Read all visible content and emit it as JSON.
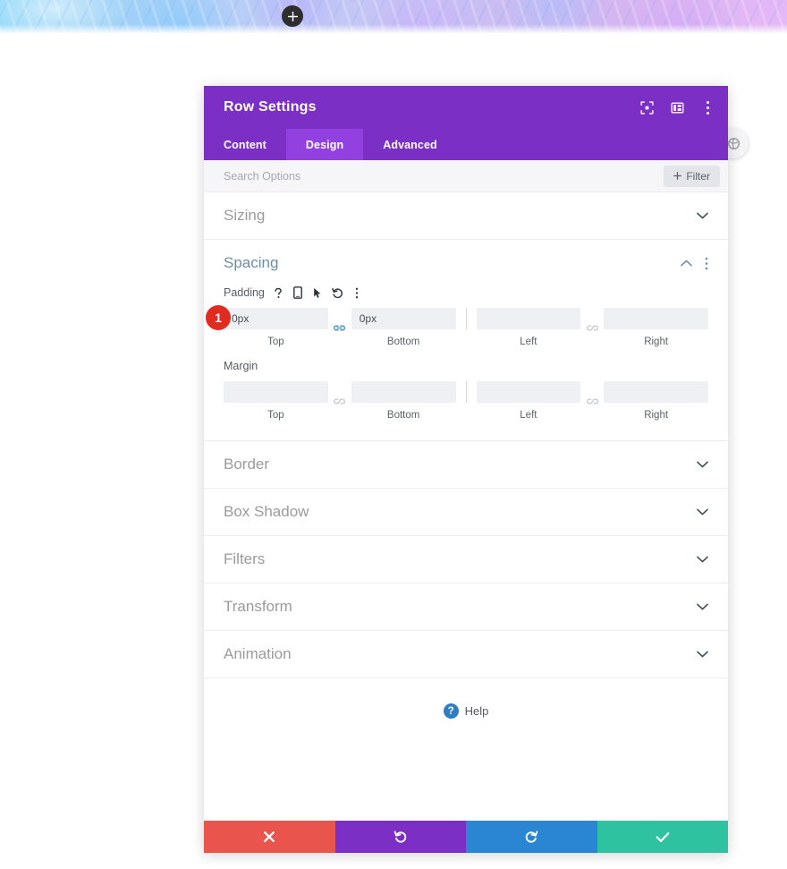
{
  "hero": {
    "add_section_icon": "plus-icon"
  },
  "floating": {
    "icon": "settings-circle-icon"
  },
  "modal": {
    "title": "Row Settings",
    "header_icons": [
      {
        "name": "fullscreen-target-icon",
        "label": "Expand"
      },
      {
        "name": "layout-panel-icon",
        "label": "Layout"
      },
      {
        "name": "more-vertical-icon",
        "label": "More"
      }
    ],
    "tabs": [
      {
        "label": "Content",
        "active": false
      },
      {
        "label": "Design",
        "active": true
      },
      {
        "label": "Advanced",
        "active": false
      }
    ],
    "search": {
      "placeholder": "Search Options",
      "value": ""
    },
    "filter_button": {
      "label": "Filter",
      "icon": "plus-icon"
    }
  },
  "sections": [
    {
      "title": "Sizing",
      "open": false
    },
    {
      "title": "Spacing",
      "open": true
    },
    {
      "title": "Border",
      "open": false
    },
    {
      "title": "Box Shadow",
      "open": false
    },
    {
      "title": "Filters",
      "open": false
    },
    {
      "title": "Transform",
      "open": false
    },
    {
      "title": "Animation",
      "open": false
    }
  ],
  "spacing": {
    "padding": {
      "label": "Padding",
      "badge": "1",
      "icons": [
        {
          "name": "help-question-icon"
        },
        {
          "name": "responsive-mobile-icon"
        },
        {
          "name": "hover-cursor-icon"
        },
        {
          "name": "reset-undo-icon"
        },
        {
          "name": "more-vertical-icon"
        }
      ],
      "fields": [
        {
          "caption": "Top",
          "value": "0px"
        },
        {
          "caption": "Bottom",
          "value": "0px"
        },
        {
          "caption": "Left",
          "value": ""
        },
        {
          "caption": "Right",
          "value": ""
        }
      ],
      "link_top_bottom": "linked",
      "link_left_right": "unlinked"
    },
    "margin": {
      "label": "Margin",
      "fields": [
        {
          "caption": "Top",
          "value": ""
        },
        {
          "caption": "Bottom",
          "value": ""
        },
        {
          "caption": "Left",
          "value": ""
        },
        {
          "caption": "Right",
          "value": ""
        }
      ],
      "link_top_bottom": "unlinked",
      "link_left_right": "unlinked"
    }
  },
  "help": {
    "label": "Help",
    "icon": "question-circle-icon"
  },
  "footer": {
    "buttons": [
      {
        "name": "cancel-button",
        "icon": "close-x-icon",
        "color": "#e9554d"
      },
      {
        "name": "undo-button",
        "icon": "undo-arrow-icon",
        "color": "#7b2fc4"
      },
      {
        "name": "redo-button",
        "icon": "redo-arrow-icon",
        "color": "#2a86d3"
      },
      {
        "name": "save-button",
        "icon": "checkmark-icon",
        "color": "#2ec2a0"
      }
    ]
  },
  "colors": {
    "header_purple": "#7b2fc4",
    "tab_active_purple": "#9340e0",
    "accent_blue": "#4a90c4",
    "badge_red": "#e02b20",
    "save_green": "#2ec2a0",
    "cancel_red": "#e9554d"
  }
}
